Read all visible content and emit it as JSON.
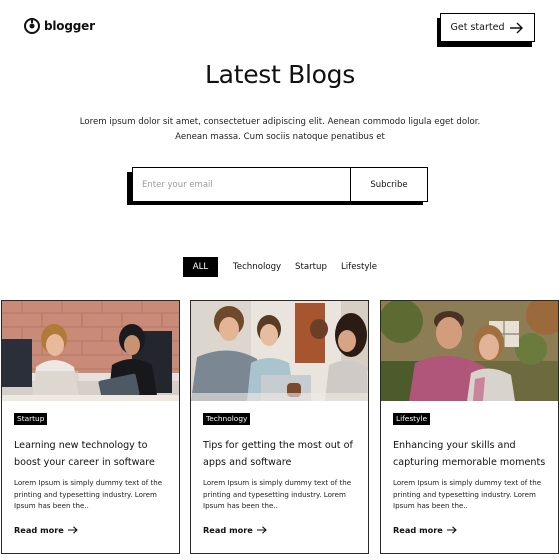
{
  "header": {
    "brand": "blogger",
    "cta_label": "Get started"
  },
  "hero": {
    "title": "Latest Blogs",
    "intro": "Lorem ipsum dolor sit amet, consectetuer adipiscing elit. Aenean commodo ligula eget dolor. Aenean massa. Cum sociis natoque penatibus et"
  },
  "subscribe": {
    "placeholder": "Enter your email",
    "button_label": "Subcribe"
  },
  "filters": {
    "all": "ALL",
    "technology": "Technology",
    "startup": "Startup",
    "lifestyle": "Lifestyle"
  },
  "cards": [
    {
      "badge": "Startup",
      "title": "Learning new technology to boost your career in software",
      "excerpt": "Lorem Ipsum is simply dummy text of the printing and typesetting industry. Lorem Ipsum has been the..",
      "read_more": "Read more"
    },
    {
      "badge": "Technology",
      "title": "Tips for getting the most out of apps and software",
      "excerpt": "Lorem Ipsum is simply dummy text of the printing and typesetting industry. Lorem Ipsum has been the..",
      "read_more": "Read more"
    },
    {
      "badge": "Lifestyle",
      "title": "Enhancing your skills and capturing memorable moments",
      "excerpt": "Lorem Ipsum is simply dummy text of the printing and typesetting industry. Lorem Ipsum has been the..",
      "read_more": "Read more"
    }
  ],
  "colors": {
    "text": "#111111",
    "accent": "#000000",
    "background": "#ffffff"
  },
  "icons": {
    "logo": "blogger-logo-icon",
    "cta_arrow": "arrow-right-icon",
    "read_more_arrow": "arrow-right-icon"
  }
}
